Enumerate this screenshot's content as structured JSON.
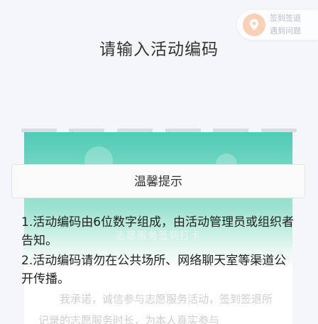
{
  "help": {
    "line1": "签到签退",
    "line2": "遇到问题"
  },
  "title": "请输入活动编码",
  "code_slot_count": 6,
  "poster": {
    "heading": "志愿服务签到打卡",
    "body": "我承诺，诚信参与志愿服务活动，签到签退所记录的志愿服务时长，为本人真实参与"
  },
  "notice": {
    "title": "温馨提示",
    "items": [
      "1.活动编码由6位数字组成，由活动管理员或组织者告知。",
      "2.活动编码请勿在公共场所、网络聊天室等渠道公开传播。"
    ]
  },
  "colors": {
    "poster_top": "#4fcbb5",
    "help_icon": "#f6b58b"
  }
}
